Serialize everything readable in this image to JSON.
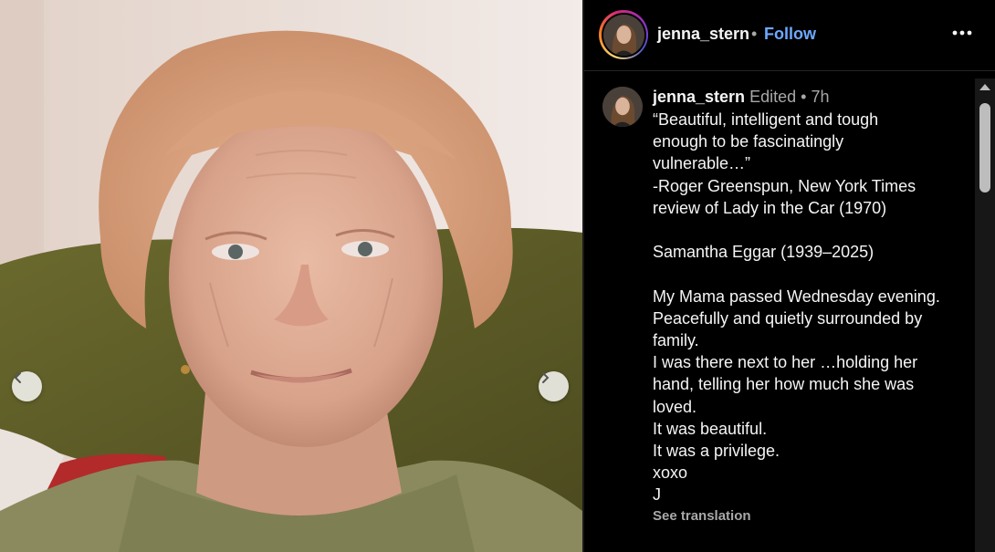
{
  "post": {
    "photo_alt": "",
    "prev_icon": "chevron-left-icon",
    "next_icon": "chevron-right-icon"
  },
  "header": {
    "username": "jenna_stern",
    "separator": "•",
    "follow_label": "Follow",
    "more_icon": "more-horizontal-icon",
    "ring_colors": [
      "#feda75",
      "#fa7e1e",
      "#d62976",
      "#962fbf",
      "#4f5bd5"
    ]
  },
  "caption": {
    "username": "jenna_stern",
    "edited": "Edited",
    "separator": "•",
    "time": "7h",
    "lines": [
      "“Beautiful, intelligent and tough",
      "enough to be fascinatingly",
      "vulnerable…”",
      "-Roger Greenspun, New York Times",
      "review of Lady in the Car (1970)",
      "",
      "Samantha Eggar (1939–2025)",
      "",
      "My Mama passed Wednesday evening.",
      "Peacefully and quietly surrounded by",
      "family.",
      "I was there next to her …holding her",
      "hand, telling her how much she was",
      "loved.",
      "It was beautiful.",
      "It was a privilege.",
      "xoxo",
      "J"
    ],
    "see_translation": "See translation"
  },
  "colors": {
    "follow": "#6ea9ff",
    "muted": "#a8a8a8",
    "background": "#000000"
  }
}
